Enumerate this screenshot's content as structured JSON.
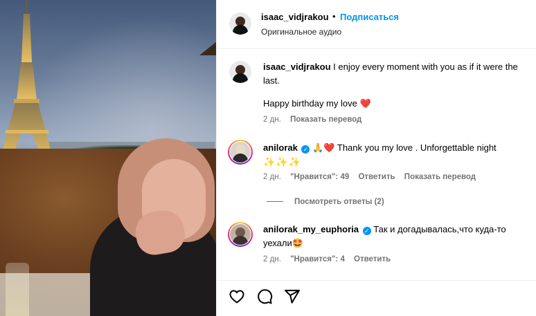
{
  "post": {
    "author": "isaac_vidjrakou",
    "separator": "•",
    "follow_label": "Подписаться",
    "audio_label": "Оригинальное аудио"
  },
  "caption": {
    "username": "isaac_vidjrakou",
    "text_line1": " I enjoy every moment with you as if it were the",
    "text_line2": "last.",
    "text_line3": "Happy birthday my love",
    "heart": "❤️",
    "time": "2 дн.",
    "translate": "Показать перевод"
  },
  "comments": [
    {
      "username": "anilorak",
      "verified_icon": "verified-badge",
      "emoji": "🙏❤️",
      "text": "Thank you my love . Unforgettable night",
      "emoji_line": "✨✨✨",
      "time": "2 дн.",
      "likes": "\"Нравится\": 49",
      "reply": "Ответить",
      "translate": "Показать перевод"
    },
    {
      "username": "anilorak_my_euphoria",
      "verified_icon": "verified-badge",
      "text_line1": " Так и догадывалась,что куда-то",
      "text_line2": "уехали",
      "emoji": "🤩",
      "time": "2 дн.",
      "likes": "\"Нравится\": 4",
      "reply": "Ответить"
    }
  ],
  "view_replies": "Посмотреть ответы (2)",
  "actions": {
    "like_icon": "heart-icon",
    "comment_icon": "comment-icon",
    "share_icon": "share-icon"
  },
  "colors": {
    "link_blue": "#0095f6",
    "secondary_text": "#737373"
  }
}
